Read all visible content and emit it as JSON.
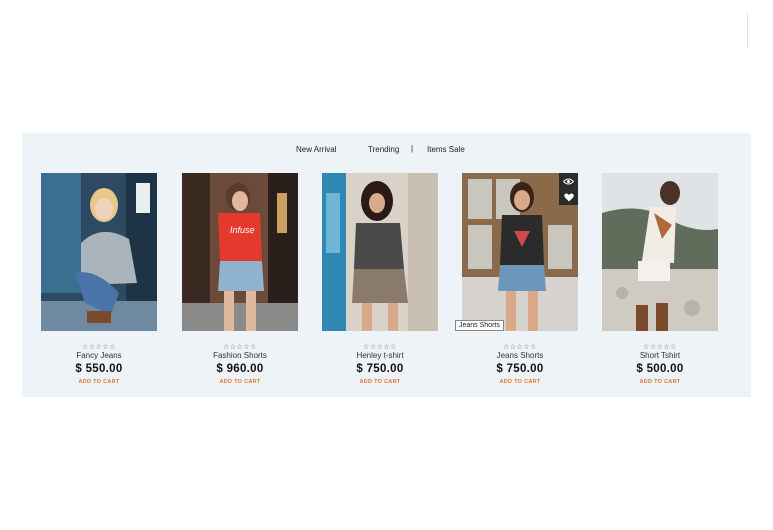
{
  "tabs": [
    {
      "label": "New Arrival"
    },
    {
      "label": "Trending"
    },
    {
      "label": "Items Sale"
    }
  ],
  "tab_separator": "|",
  "colors": {
    "accent": "#e8742a",
    "section_bg": "#eef3f8"
  },
  "products": [
    {
      "name": "Fancy Jeans",
      "price": "$ 550.00",
      "rating": "☆☆☆☆☆",
      "cta": "ADD TO CART"
    },
    {
      "name": "Fashion Shorts",
      "price": "$ 960.00",
      "rating": "☆☆☆☆☆",
      "cta": "ADD TO CART"
    },
    {
      "name": "Henley t-shirt",
      "price": "$ 750.00",
      "rating": "☆☆☆☆☆",
      "cta": "ADD TO CART"
    },
    {
      "name": "Jeans Shorts",
      "price": "$ 750.00",
      "rating": "☆☆☆☆☆",
      "cta": "ADD TO CART"
    },
    {
      "name": "Short Tshirt",
      "price": "$ 500.00",
      "rating": "☆☆☆☆☆",
      "cta": "ADD TO CART"
    }
  ],
  "hover_overlay": {
    "icons": [
      "eye-icon",
      "heart-icon"
    ]
  },
  "tooltip": {
    "text": "Jeans Shorts"
  }
}
